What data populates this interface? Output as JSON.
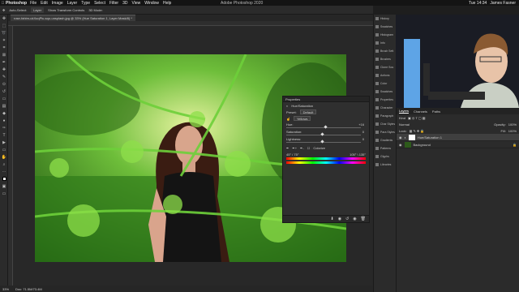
{
  "menubar": {
    "apple": "",
    "app": "Photoshop",
    "items": [
      "File",
      "Edit",
      "Image",
      "Layer",
      "Type",
      "Select",
      "Filter",
      "3D",
      "View",
      "Window",
      "Help"
    ],
    "title": "Adobe Photoshop 2020",
    "clock": "Tue 14:34",
    "user": "James Fasner"
  },
  "options": {
    "auto_select": "Auto-Select:",
    "layer": "Layer",
    "transform": "Show Transform Controls",
    "mode": "3D Mode:"
  },
  "document_tab": "rose-fahim-ukXuqPlu-sqo-unsplash.jpg @ 33% (Hue Saturation 1, Layer Mask/8) *",
  "statusbar": {
    "zoom": "33%",
    "info": "Doc: 71.5M/73.4M"
  },
  "properties": {
    "header": "Properties",
    "panel_title": "Hue/Saturation",
    "preset_label": "Preset:",
    "preset_value": "Default",
    "channel": "Yellows",
    "hue_label": "Hue:",
    "hue_value": "+16",
    "saturation_label": "Saturation:",
    "saturation_value": "0",
    "lightness_label": "Lightness:",
    "lightness_value": "0",
    "colorize": "Colorize",
    "range_left": "45° / 75°",
    "range_right": "105° \\ 135°",
    "hue_level": 0.54,
    "saturation_level": 0.5,
    "lightness_level": 0.5
  },
  "right_column": {
    "items": [
      "History",
      "Swatches",
      "Histogram",
      "Info",
      "Brush Sett",
      "Brushes",
      "Clone Sou",
      "Actions",
      "Color",
      "Swatches",
      "Properties",
      "Character",
      "Paragraph",
      "Char Styles",
      "Para Styles",
      "Gradients",
      "Patterns",
      "Glyphs",
      "Libraries"
    ]
  },
  "layers_panel": {
    "tabs": [
      "Layers",
      "Channels",
      "Paths"
    ],
    "kind": "Kind",
    "blend": "Normal",
    "opacity_label": "Opacity:",
    "opacity_value": "100%",
    "lock_label": "Lock:",
    "fill_label": "Fill:",
    "fill_value": "100%",
    "layers": [
      {
        "name": "Hue/Saturation 1"
      },
      {
        "name": "Background"
      }
    ]
  },
  "colors": {
    "accent": "#1473e6",
    "panel": "#2b2b2b"
  }
}
